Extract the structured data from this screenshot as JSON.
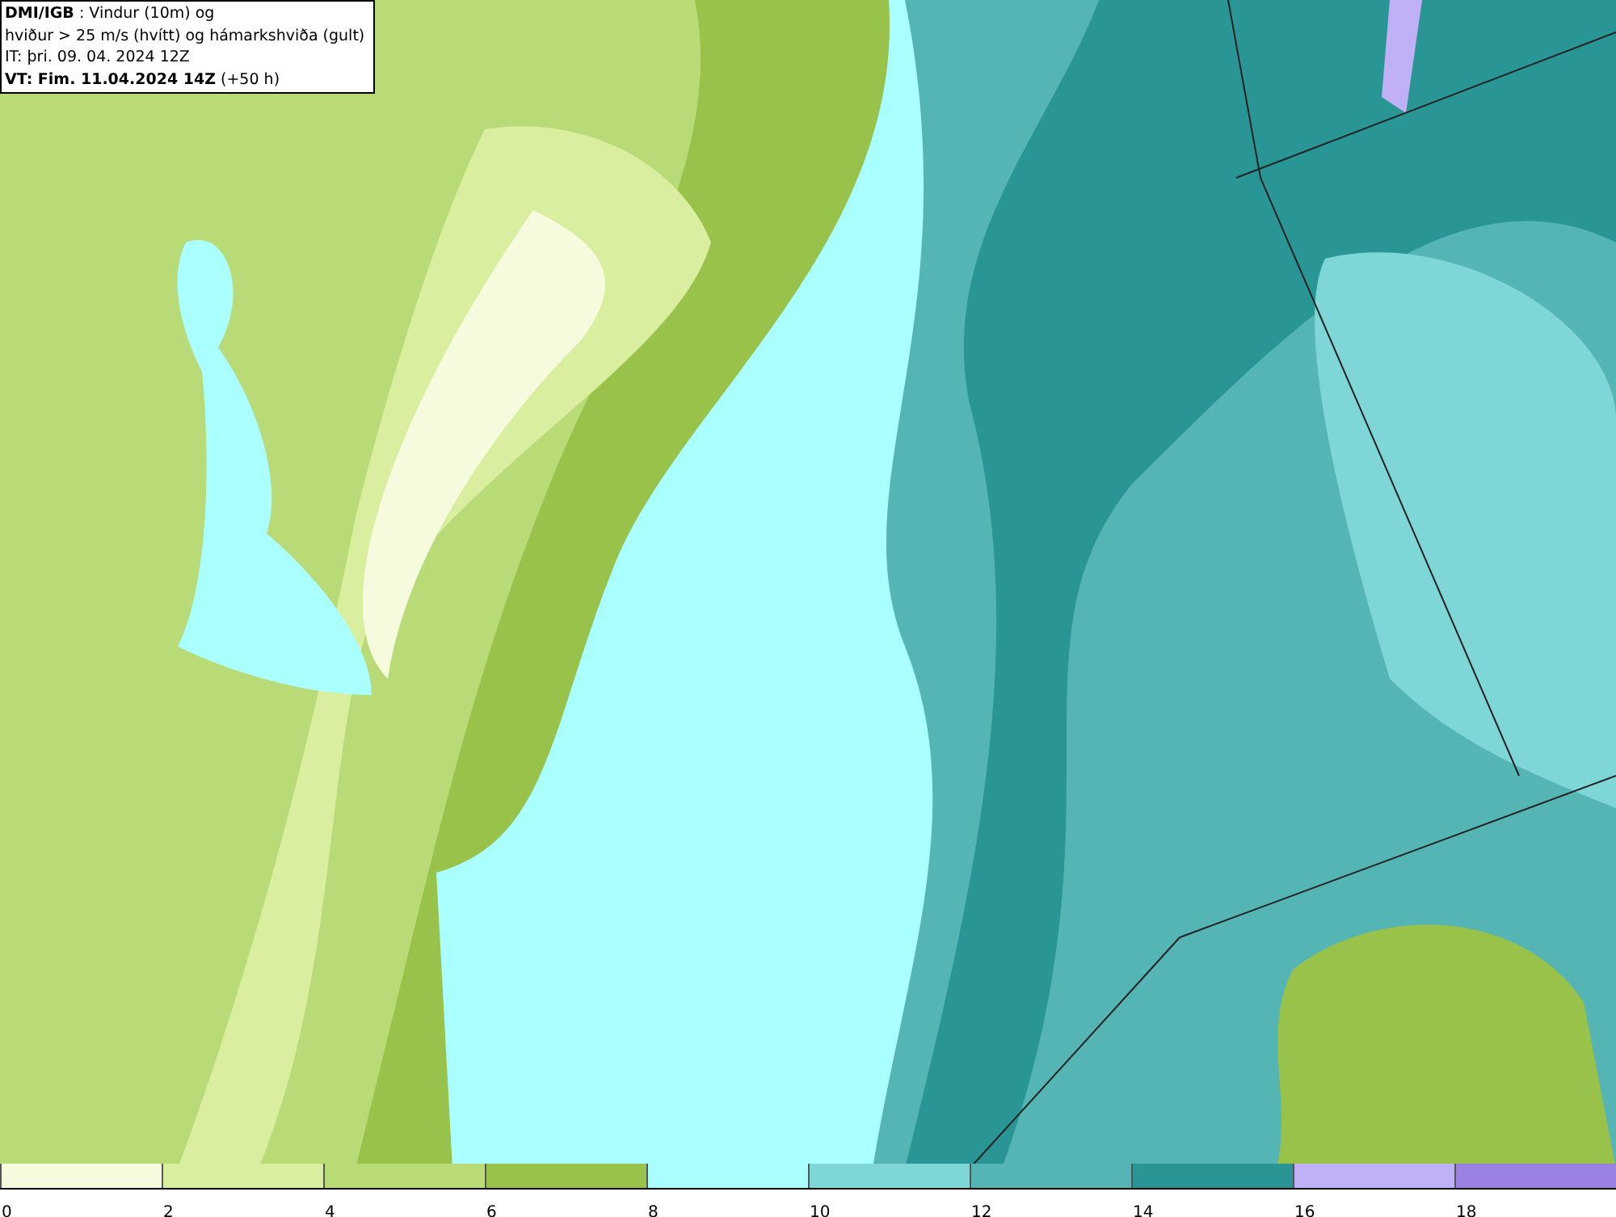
{
  "header": {
    "lines": [
      "**DMI/IGB** : Vindur (10m) og",
      "hviður > 25 m/s (hvítt) og hámarkshviða (gult)",
      "IT: þri. 09. 04. 2024 12Z",
      "**VT: Fim. 11.04.2024 14Z** (+50 h)"
    ]
  },
  "legend": {
    "segments": [
      {
        "color": "#f5fbdc",
        "label": "0"
      },
      {
        "color": "#d9ef9f",
        "label": "2"
      },
      {
        "color": "#b8db78",
        "label": "4"
      },
      {
        "color": "#98c24a",
        "label": "6"
      },
      {
        "color": "#aaffff",
        "label": "8"
      },
      {
        "color": "#7fd6d6",
        "label": "10"
      },
      {
        "color": "#55b5b5",
        "label": "12"
      },
      {
        "color": "#2a9595",
        "label": "14"
      },
      {
        "color": "#c0b0f5",
        "label": "16"
      },
      {
        "color": "#9a80e0",
        "label": "18"
      }
    ]
  }
}
